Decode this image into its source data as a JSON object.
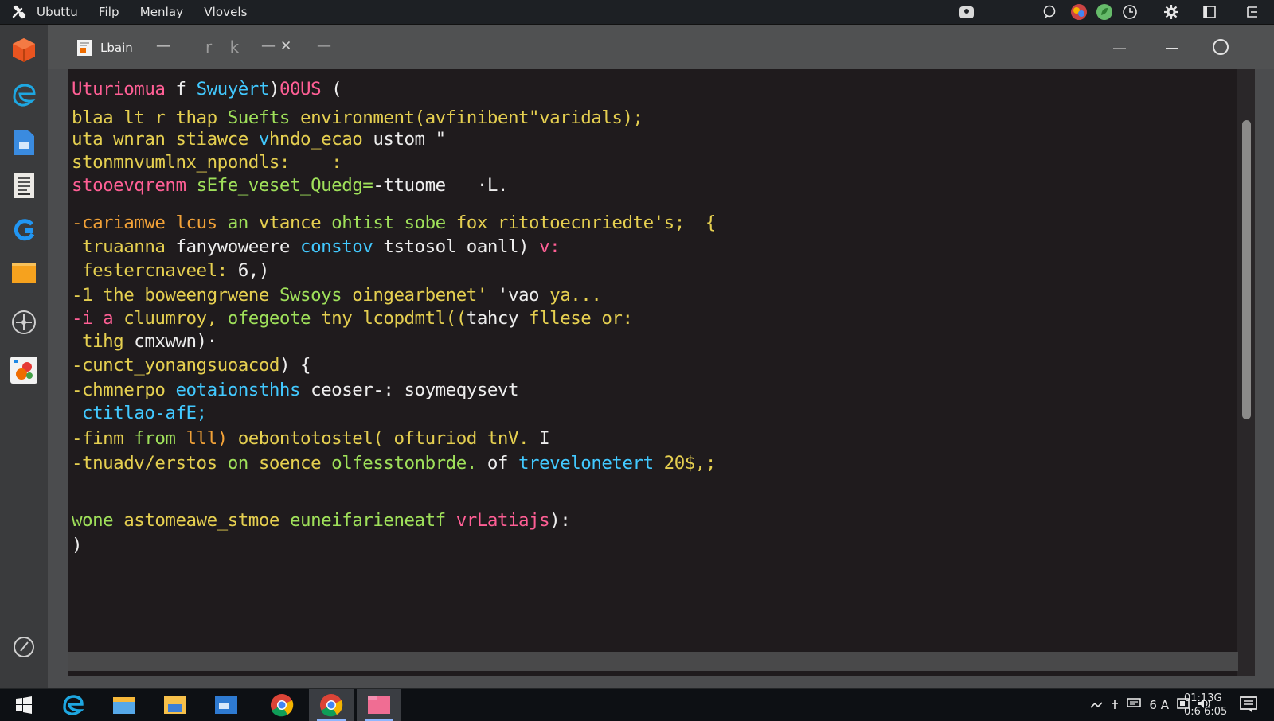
{
  "topbar": {
    "logo_icon": "tools-icon",
    "menu": [
      "Ubuttu",
      "Filp",
      "Menlay",
      "Vlovels"
    ]
  },
  "launcher": {
    "items": [
      "ubuntu-software-icon",
      "edge-browser-icon",
      "document-icon",
      "text-editor-icon",
      "refresh-app-icon",
      "folder-icon",
      "settings-cross-icon",
      "apps-icon",
      "history-icon"
    ]
  },
  "window": {
    "tab": {
      "title": "Lbain",
      "minimize": "—",
      "ghost_label": "r k",
      "dash": "—",
      "close": "✕"
    },
    "new_tab": "—"
  },
  "terminal": {
    "lines": [
      [
        {
          "t": "Uturiomua ",
          "c": "pink"
        },
        {
          "t": "f ",
          "c": "wht"
        },
        {
          "t": "Swuyèrt",
          "c": "blue"
        },
        {
          "t": ")",
          "c": "wht"
        },
        {
          "t": "00US ",
          "c": "pink"
        },
        {
          "t": "(",
          "c": "wht"
        }
      ],
      [
        {
          "t": "blaa lt r thap ",
          "c": "yel"
        },
        {
          "t": "Suefts ",
          "c": "grn"
        },
        {
          "t": "environment(avfinibent\"varidals);",
          "c": "yel"
        }
      ],
      [
        {
          "t": "uta wnran stiawce ",
          "c": "yel"
        },
        {
          "t": "v",
          "c": "blue"
        },
        {
          "t": "hndo_ecao ",
          "c": "yel"
        },
        {
          "t": "ustom ",
          "c": "wht"
        },
        {
          "t": "\"",
          "c": "wht"
        }
      ],
      [
        {
          "t": "stonmnvumlnx_npondls:    :",
          "c": "yel"
        }
      ],
      [
        {
          "t": "stooevqrenm ",
          "c": "pink"
        },
        {
          "t": "sEfe_veset_Quedg=",
          "c": "grn"
        },
        {
          "t": "-ttuome   ·L.",
          "c": "wht"
        }
      ],
      [
        {
          "t": "-cariamwe lcus ",
          "c": "orange"
        },
        {
          "t": "an ",
          "c": "grn"
        },
        {
          "t": "vtance ",
          "c": "yel"
        },
        {
          "t": "ohtist sobe ",
          "c": "grn"
        },
        {
          "t": "fox ",
          "c": "yel"
        },
        {
          "t": "ritotoecnriedte's;  {",
          "c": "yel"
        }
      ],
      [
        {
          "t": " truaanna ",
          "c": "yel"
        },
        {
          "t": "fanywoweere ",
          "c": "wht"
        },
        {
          "t": "constov ",
          "c": "blue"
        },
        {
          "t": "tstosol oanll) ",
          "c": "wht"
        },
        {
          "t": "v:",
          "c": "pink"
        }
      ],
      [
        {
          "t": " festercnaveel: ",
          "c": "yel"
        },
        {
          "t": "6,)",
          "c": "wht"
        }
      ],
      [
        {
          "t": "-1 the boweengrwene ",
          "c": "yel"
        },
        {
          "t": "Swsoys ",
          "c": "grn"
        },
        {
          "t": "oingearbenet' ",
          "c": "yel"
        },
        {
          "t": "'vao ",
          "c": "wht"
        },
        {
          "t": "ya...",
          "c": "yel"
        }
      ],
      [
        {
          "t": "-i a ",
          "c": "pink"
        },
        {
          "t": "cluumroy, ",
          "c": "yel"
        },
        {
          "t": "ofegeote ",
          "c": "grn"
        },
        {
          "t": "tny ",
          "c": "yel"
        },
        {
          "t": "lcopdmtl((",
          "c": "yel"
        },
        {
          "t": "tahcy ",
          "c": "wht"
        },
        {
          "t": "fllese or:",
          "c": "yel"
        }
      ],
      [
        {
          "t": " tihg ",
          "c": "yel"
        },
        {
          "t": "cmxwwn)·",
          "c": "wht"
        }
      ],
      [
        {
          "t": "-cunct_yonangsuoacod",
          "c": "yel"
        },
        {
          "t": ") {",
          "c": "wht"
        }
      ],
      [
        {
          "t": "-chmnerpo ",
          "c": "yel"
        },
        {
          "t": "eotaionsthhs ",
          "c": "blue"
        },
        {
          "t": "ceoser-: soymeqysevt",
          "c": "wht"
        }
      ],
      [
        {
          "t": " ctitlao-afE;",
          "c": "blue"
        }
      ],
      [
        {
          "t": "-finm ",
          "c": "yel"
        },
        {
          "t": "from ",
          "c": "grn"
        },
        {
          "t": "lll) ",
          "c": "orange"
        },
        {
          "t": "oebontotostel( ",
          "c": "yel"
        },
        {
          "t": "ofturiod tnV. ",
          "c": "yel"
        },
        {
          "t": "I",
          "c": "wht"
        }
      ],
      [
        {
          "t": "-tnuadv/erstos ",
          "c": "yel"
        },
        {
          "t": "on ",
          "c": "grn"
        },
        {
          "t": "soence ",
          "c": "yel"
        },
        {
          "t": "olfesstonbrde. ",
          "c": "grn"
        },
        {
          "t": "of ",
          "c": "wht"
        },
        {
          "t": "trevelonetert ",
          "c": "blue"
        },
        {
          "t": "20$,;",
          "c": "yel"
        }
      ],
      [],
      [
        {
          "t": "wone ",
          "c": "grn"
        },
        {
          "t": "astomeawe_stmoe ",
          "c": "yel"
        },
        {
          "t": "euneifarieneatf ",
          "c": "grn"
        },
        {
          "t": "vrLatiajs",
          "c": "pink"
        },
        {
          "t": "):",
          "c": "wht"
        }
      ],
      [
        {
          "t": ")",
          "c": "wht"
        }
      ]
    ]
  },
  "taskbar": {
    "items": [
      "windows-start-icon",
      "edge-icon",
      "file-explorer-icon",
      "folder-icon",
      "store-icon",
      "chrome-icon",
      "chrome-active-icon",
      "files-pink-icon"
    ],
    "tray_text": "6 A",
    "clock_line1": "01:13G",
    "clock_line2": "0:6 6:05"
  }
}
